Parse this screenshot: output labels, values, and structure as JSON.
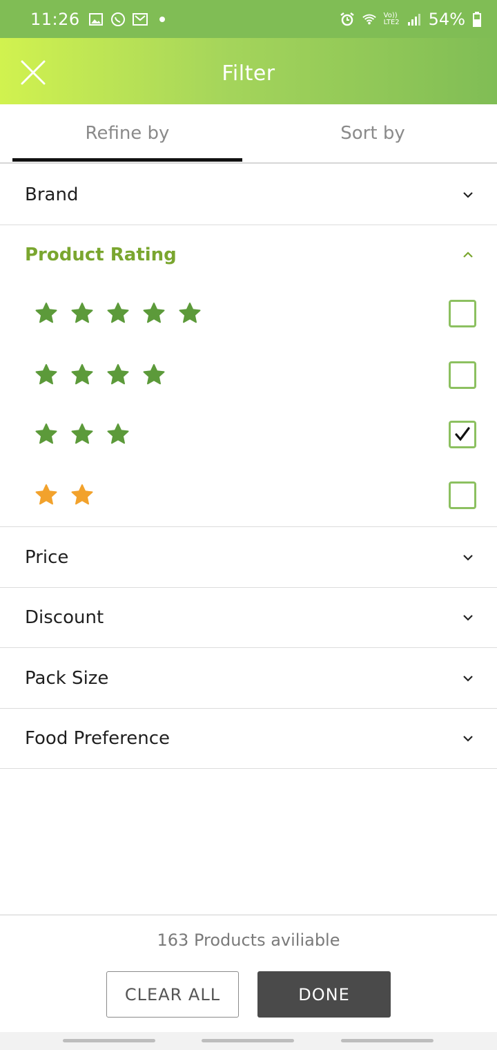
{
  "status_bar": {
    "time": "11:26",
    "battery": "54%",
    "left_icons": [
      "image-icon",
      "whatsapp-icon",
      "gmail-icon",
      "dot-icon"
    ],
    "right_icons": [
      "alarm-icon",
      "wifi-icon",
      "lte-icon",
      "signal-icon",
      "battery-icon"
    ],
    "lte_label": "LTE2",
    "volte_label": "Vo))"
  },
  "header": {
    "title": "Filter",
    "close_icon": "close-icon"
  },
  "tabs": [
    {
      "label": "Refine by",
      "active": true
    },
    {
      "label": "Sort by",
      "active": false
    }
  ],
  "sections": {
    "brand": "Brand",
    "product_rating": "Product Rating",
    "price": "Price",
    "discount": "Discount",
    "pack_size": "Pack Size",
    "food_preference": "Food Preference"
  },
  "ratings": [
    {
      "stars": 5,
      "checked": false,
      "star_color": "#5c9a3a"
    },
    {
      "stars": 4,
      "checked": false,
      "star_color": "#5c9a3a"
    },
    {
      "stars": 3,
      "checked": true,
      "star_color": "#5c9a3a"
    },
    {
      "stars": 2,
      "checked": false,
      "star_color": "#f2a22c"
    }
  ],
  "footer": {
    "products_text": "163 Products aviliable",
    "clear_label": "CLEAR ALL",
    "done_label": "DONE"
  },
  "colors": {
    "accent": "#7aa62f",
    "status_bar": "#80bd55",
    "checkbox_border": "#8cc060"
  }
}
